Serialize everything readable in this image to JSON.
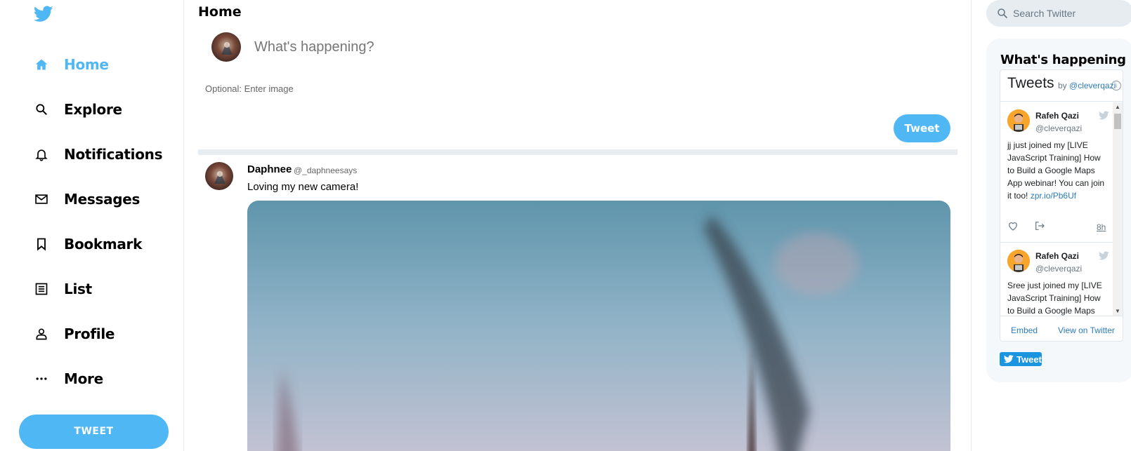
{
  "sidebar": {
    "items": [
      {
        "label": "Home",
        "icon": "home-icon",
        "active": true
      },
      {
        "label": "Explore",
        "icon": "search-icon"
      },
      {
        "label": "Notifications",
        "icon": "bell-icon"
      },
      {
        "label": "Messages",
        "icon": "mail-icon"
      },
      {
        "label": "Bookmark",
        "icon": "bookmark-icon"
      },
      {
        "label": "List",
        "icon": "list-icon"
      },
      {
        "label": "Profile",
        "icon": "person-icon"
      },
      {
        "label": "More",
        "icon": "more-icon"
      }
    ],
    "tweet_button": "TWEET"
  },
  "feed": {
    "title": "Home",
    "compose": {
      "placeholder": "What's happening?",
      "image_placeholder": "Optional: Enter image",
      "tweet_button": "Tweet"
    },
    "post": {
      "name": "Daphnee",
      "handle": "@_daphneesays",
      "text": "Loving my new camera!"
    }
  },
  "widgets": {
    "search_placeholder": "Search Twitter",
    "title": "What's happening",
    "timeline": {
      "header": "Tweets",
      "by": "by",
      "by_handle": "@cleverqazi",
      "tweets": [
        {
          "name": "Rafeh Qazi",
          "handle": "@cleverqazi",
          "text": "jj just joined my [LIVE JavaScript Training] How to Build a Google Maps App webinar! You can join it too!",
          "link": "zpr.io/Pb6Uf",
          "time": "8h"
        },
        {
          "name": "Rafeh Qazi",
          "handle": "@cleverqazi",
          "text": "Sree just joined my [LIVE JavaScript Training] How to Build a Google Maps",
          "link": "",
          "time": ""
        }
      ],
      "embed": "Embed",
      "view_on_twitter": "View on Twitter"
    },
    "share_button": "Tweet"
  },
  "colors": {
    "accent": "#50b7f5",
    "divider": "#e6ecf0",
    "widget_bg": "#f5f8fa",
    "link": "#2b7bb9"
  }
}
